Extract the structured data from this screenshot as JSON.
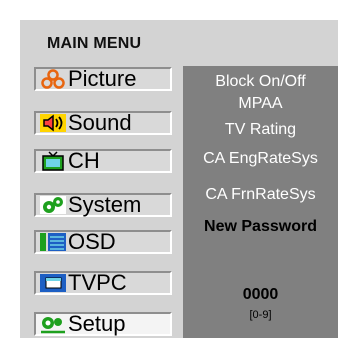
{
  "menu": {
    "title": "MAIN MENU",
    "items": [
      {
        "label": "Picture",
        "icon": "picture-icon",
        "selected": false
      },
      {
        "label": "Sound",
        "icon": "speaker-icon",
        "selected": false
      },
      {
        "label": "CH",
        "icon": "tv-icon",
        "selected": false
      },
      {
        "label": "System",
        "icon": "gears-icon",
        "selected": false
      },
      {
        "label": "OSD",
        "icon": "osd-icon",
        "selected": false
      },
      {
        "label": "TVPC",
        "icon": "monitor-icon",
        "selected": false
      },
      {
        "label": "Setup",
        "icon": "setup-icon",
        "selected": true
      }
    ]
  },
  "submenu": {
    "options": [
      {
        "label": "Block On/Off",
        "active": false
      },
      {
        "label": "MPAA",
        "active": false
      },
      {
        "label": "TV Rating",
        "active": false
      },
      {
        "label": "CA EngRateSys",
        "active": false
      },
      {
        "label": "CA FrnRateSys",
        "active": false
      },
      {
        "label": "New Password",
        "active": true
      }
    ],
    "password_value": "0000",
    "password_range": "[0-9]"
  },
  "colors": {
    "panel": "#d3d3d3",
    "submenu_bg": "#808080",
    "submenu_text": "#ffffff",
    "active_text": "#000000",
    "icon_orange": "#e8650f",
    "icon_yellow": "#ffd400",
    "icon_green": "#1ea01e",
    "icon_blue": "#1d5fc4",
    "icon_cyan": "#6fd4e6"
  }
}
